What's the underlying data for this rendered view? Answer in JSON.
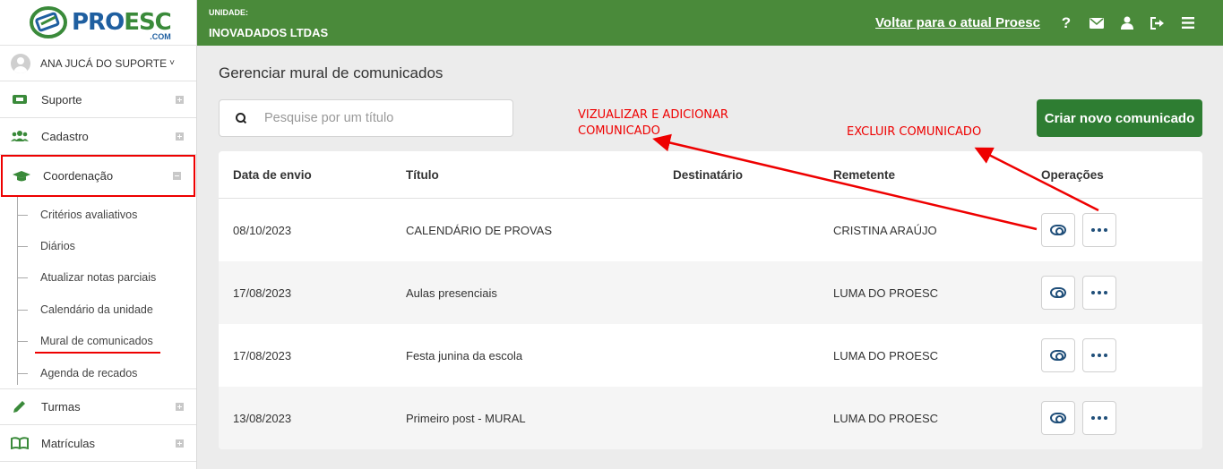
{
  "brand": {
    "logo_main": "PRO",
    "logo_accent": "ESC",
    "logo_sub": ".COM"
  },
  "user": {
    "name": "ANA JUCÁ DO SUPORTE",
    "chevron": "˅"
  },
  "sidebar": {
    "items_top": [
      {
        "label": "Suporte",
        "icon": "support-icon"
      },
      {
        "label": "Cadastro",
        "icon": "users-icon"
      },
      {
        "label": "Coordenação",
        "icon": "graduation-cap-icon",
        "expanded": true
      }
    ],
    "subitems": [
      {
        "label": "Critérios avaliativos"
      },
      {
        "label": "Diários"
      },
      {
        "label": "Atualizar notas parciais"
      },
      {
        "label": "Calendário da unidade"
      },
      {
        "label": "Mural de comunicados",
        "current": true
      },
      {
        "label": "Agenda de recados"
      }
    ],
    "items_bottom": [
      {
        "label": "Turmas",
        "icon": "pencil-icon"
      },
      {
        "label": "Matrículas",
        "icon": "book-icon"
      }
    ]
  },
  "header": {
    "unit_label": "UNIDADE:",
    "unit_name": "INOVADADOS LTDAS",
    "back_link": "Voltar para o atual Proesc",
    "help_glyph": "?",
    "icons": [
      "help-icon",
      "mail-icon",
      "user-icon",
      "logout-icon",
      "menu-icon"
    ]
  },
  "main": {
    "title": "Gerenciar mural de comunicados",
    "search_placeholder": "Pesquise por um título",
    "create_button": "Criar novo comunicado"
  },
  "annotations": {
    "view_add_line1": "VIZUALIZAR E ADICIONAR",
    "view_add_line2": "COMUNICADO",
    "delete": "EXCLUIR COMUNICADO",
    "color": "#e00000"
  },
  "table": {
    "headers": {
      "date": "Data de envio",
      "title": "Título",
      "recipient": "Destinatário",
      "sender": "Remetente",
      "ops": "Operações"
    },
    "rows": [
      {
        "date": "08/10/2023",
        "title": "CALENDÁRIO DE PROVAS",
        "recipient": "",
        "sender": "CRISTINA ARAÚJO"
      },
      {
        "date": "17/08/2023",
        "title": "Aulas presenciais",
        "recipient": "",
        "sender": "LUMA DO PROESC"
      },
      {
        "date": "17/08/2023",
        "title": "Festa junina da escola",
        "recipient": "",
        "sender": "LUMA DO PROESC"
      },
      {
        "date": "13/08/2023",
        "title": "Primeiro post - MURAL",
        "recipient": "",
        "sender": "LUMA DO PROESC"
      }
    ]
  },
  "colors": {
    "header_green": "#4a8a3a",
    "button_green": "#2e7d32",
    "brand_blue": "#1f5fa0",
    "icon_blue": "#1f4e79"
  }
}
